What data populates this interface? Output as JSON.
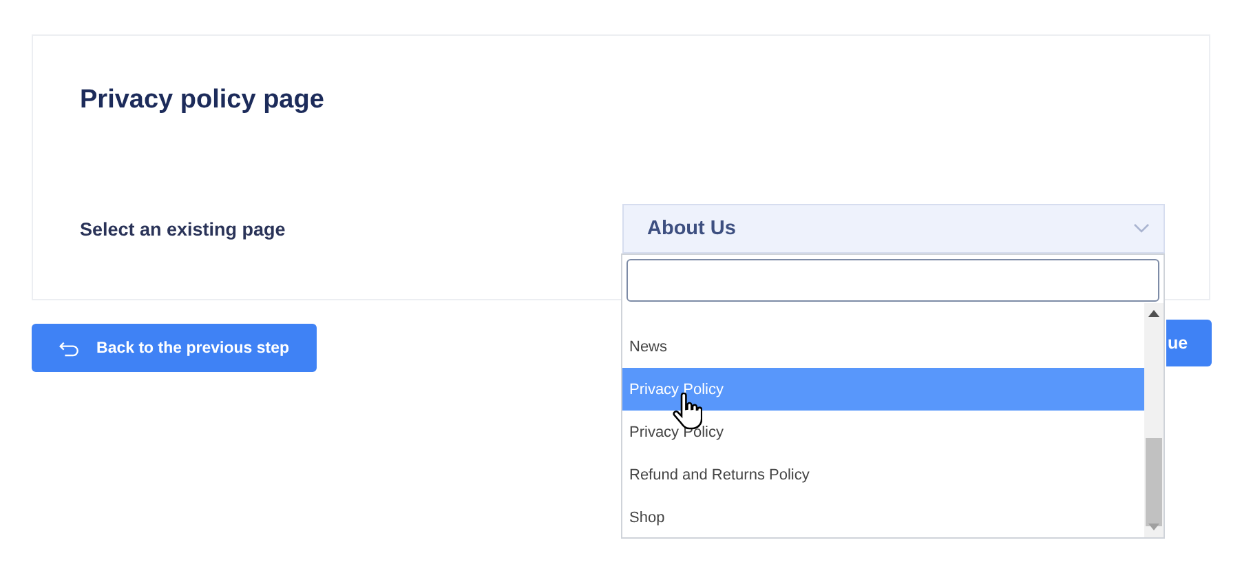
{
  "card": {
    "title": "Privacy policy page",
    "field_label": "Select an existing page"
  },
  "select": {
    "value": "About Us",
    "expanded": true,
    "options": [
      {
        "label": "News",
        "selected": false
      },
      {
        "label": "Privacy Policy",
        "selected": true
      },
      {
        "label": "Privacy Policy",
        "selected": false
      },
      {
        "label": "Refund and Returns Policy",
        "selected": false
      },
      {
        "label": "Shop",
        "selected": false
      }
    ]
  },
  "buttons": [
    {
      "kind": "back",
      "label": "Back to the previous step"
    },
    {
      "kind": "next",
      "label": "ue"
    }
  ]
}
